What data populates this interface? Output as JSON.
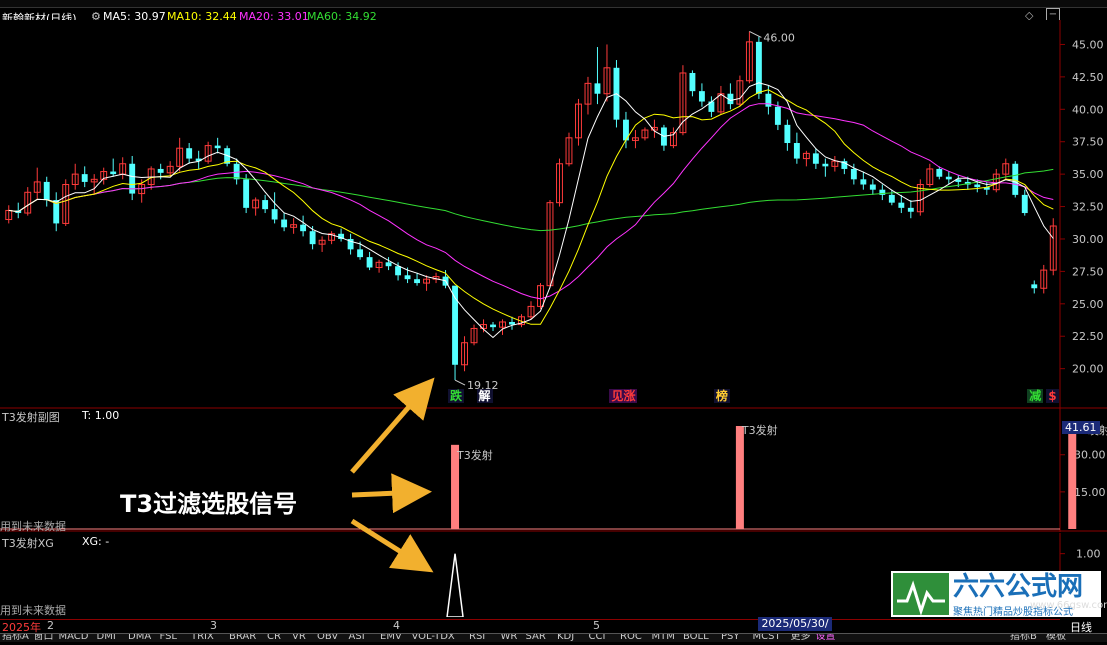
{
  "header": {
    "stock_name": "新翰新材(日线)",
    "ma5": "MA5: 30.97",
    "ma10": "MA10: 32.44",
    "ma20": "MA20: 33.01",
    "ma60": "MA60: 34.92"
  },
  "colors": {
    "up": "#ff3b3b",
    "down": "#54ffff",
    "ma5": "#ffffff",
    "ma10": "#ffff00",
    "ma20": "#ff33ff",
    "ma60": "#33dd33",
    "grid": "#8b0000",
    "bar": "#ff7f7f",
    "annotation_arrow": "#f2b02e"
  },
  "signals": [
    {
      "label": "跌",
      "color": "#33dd33"
    },
    {
      "label": "解",
      "color": "#ffffff"
    },
    {
      "label": "见涨",
      "color": "#ff3b3b"
    },
    {
      "label": "榜",
      "color": "#ffcc33"
    },
    {
      "label": "减",
      "color": "#33dd33"
    },
    {
      "label": "$",
      "color": "#ff3b3b"
    }
  ],
  "price_marks": {
    "high": "46.00",
    "low": "19.12"
  },
  "sub1": {
    "title": "T3发射副图",
    "value": "T: 1.00",
    "bar_label": "T3发射",
    "current_value": "41.61",
    "footer": "用到未来数据"
  },
  "sub2": {
    "title": "T3发射XG",
    "value": "XG: -",
    "footer": "用到未来数据"
  },
  "annotation": {
    "text": "T3过滤选股信号"
  },
  "x_axis": {
    "year": "2025年",
    "months": [
      "2",
      "3",
      "4",
      "5"
    ],
    "date_box": "2025/05/30/五",
    "period": "日线"
  },
  "bottom_tabs": [
    "指标A",
    "窗口",
    "MACD",
    "DMI",
    "DMA",
    "FSL",
    "TRIX",
    "BRAR",
    "CR",
    "VR",
    "OBV",
    "ASI",
    "EMV",
    "VOL-TDX",
    "RSI",
    "WR",
    "SAR",
    "KDJ",
    "CCI",
    "ROC",
    "MTM",
    "BOLL",
    "PSY",
    "MCST",
    "更多",
    "设置"
  ],
  "bottom_right": [
    "指标B",
    "模板"
  ],
  "logo": {
    "main": "六六公式网",
    "sub": "聚焦热门精品炒股指标公式",
    "url": "www.66gsw.com"
  },
  "chart_data": [
    {
      "type": "candlestick",
      "ylim": [
        18.2,
        46.5
      ],
      "yticks": [
        20.0,
        22.5,
        25.0,
        27.5,
        30.0,
        32.5,
        35.0,
        37.5,
        40.0,
        42.5,
        45.0
      ],
      "ohlc": [
        [
          31.5,
          32.6,
          31.2,
          32.2
        ],
        [
          32.2,
          32.8,
          31.6,
          32.0
        ],
        [
          32.0,
          34.0,
          31.8,
          33.6
        ],
        [
          33.6,
          35.5,
          33.0,
          34.4
        ],
        [
          34.4,
          34.8,
          32.5,
          33.0
        ],
        [
          33.0,
          33.6,
          30.6,
          31.2
        ],
        [
          31.2,
          34.6,
          31.0,
          34.2
        ],
        [
          34.2,
          35.8,
          33.8,
          35.0
        ],
        [
          35.0,
          35.6,
          34.0,
          34.4
        ],
        [
          34.4,
          35.0,
          33.4,
          34.6
        ],
        [
          34.6,
          35.5,
          34.2,
          35.2
        ],
        [
          35.2,
          36.2,
          34.8,
          35.0
        ],
        [
          35.0,
          36.3,
          34.6,
          35.8
        ],
        [
          35.8,
          36.4,
          33.0,
          33.5
        ],
        [
          33.5,
          34.6,
          32.8,
          34.2
        ],
        [
          34.2,
          35.6,
          33.8,
          35.4
        ],
        [
          35.4,
          35.8,
          34.6,
          35.1
        ],
        [
          35.1,
          36.0,
          34.8,
          35.6
        ],
        [
          35.6,
          37.8,
          35.2,
          37.0
        ],
        [
          37.0,
          37.4,
          35.8,
          36.2
        ],
        [
          36.2,
          36.8,
          35.4,
          36.0
        ],
        [
          36.0,
          37.5,
          35.8,
          37.2
        ],
        [
          37.2,
          37.8,
          36.6,
          37.0
        ],
        [
          37.0,
          37.2,
          35.6,
          35.8
        ],
        [
          35.8,
          36.2,
          34.2,
          34.6
        ],
        [
          34.6,
          35.0,
          32.0,
          32.4
        ],
        [
          32.4,
          33.2,
          31.8,
          33.0
        ],
        [
          33.0,
          33.4,
          32.0,
          32.3
        ],
        [
          32.3,
          33.6,
          31.2,
          31.5
        ],
        [
          31.5,
          32.0,
          30.6,
          30.9
        ],
        [
          30.9,
          31.6,
          30.4,
          31.1
        ],
        [
          31.1,
          31.8,
          30.2,
          30.6
        ],
        [
          30.6,
          31.0,
          29.2,
          29.6
        ],
        [
          29.6,
          30.2,
          29.0,
          29.9
        ],
        [
          29.9,
          30.6,
          29.6,
          30.4
        ],
        [
          30.4,
          30.8,
          29.8,
          30.0
        ],
        [
          30.0,
          30.4,
          28.8,
          29.2
        ],
        [
          29.2,
          29.8,
          28.4,
          28.6
        ],
        [
          28.6,
          29.0,
          27.6,
          27.8
        ],
        [
          27.8,
          28.4,
          27.4,
          28.2
        ],
        [
          28.2,
          28.6,
          27.6,
          27.9
        ],
        [
          27.9,
          28.2,
          26.8,
          27.2
        ],
        [
          27.2,
          27.8,
          26.6,
          26.9
        ],
        [
          26.9,
          27.4,
          26.4,
          26.6
        ],
        [
          26.6,
          27.2,
          26.0,
          26.9
        ],
        [
          26.9,
          27.4,
          26.6,
          27.1
        ],
        [
          27.1,
          27.6,
          26.2,
          26.4
        ],
        [
          26.4,
          25.0,
          19.12,
          20.3
        ],
        [
          20.3,
          22.5,
          19.8,
          22.0
        ],
        [
          22.0,
          23.4,
          21.8,
          23.1
        ],
        [
          23.1,
          23.8,
          22.8,
          23.4
        ],
        [
          23.4,
          23.6,
          22.9,
          23.2
        ],
        [
          23.2,
          23.8,
          22.6,
          23.6
        ],
        [
          23.6,
          24.0,
          23.0,
          23.4
        ],
        [
          23.4,
          24.2,
          23.2,
          24.0
        ],
        [
          24.0,
          25.2,
          23.8,
          24.8
        ],
        [
          24.8,
          26.6,
          24.6,
          26.4
        ],
        [
          26.4,
          33.0,
          26.2,
          32.8
        ],
        [
          32.8,
          36.2,
          32.5,
          35.8
        ],
        [
          35.8,
          38.2,
          35.6,
          37.8
        ],
        [
          37.8,
          40.8,
          37.2,
          40.4
        ],
        [
          40.4,
          42.5,
          39.6,
          42.0
        ],
        [
          42.0,
          44.8,
          40.4,
          41.2
        ],
        [
          41.2,
          45.0,
          40.6,
          43.2
        ],
        [
          43.2,
          43.8,
          38.6,
          39.2
        ],
        [
          39.2,
          39.8,
          37.0,
          37.6
        ],
        [
          37.6,
          38.4,
          37.0,
          37.8
        ],
        [
          37.8,
          38.6,
          37.6,
          38.4
        ],
        [
          38.4,
          39.2,
          37.8,
          38.6
        ],
        [
          38.6,
          38.8,
          36.8,
          37.2
        ],
        [
          37.2,
          38.6,
          37.0,
          38.2
        ],
        [
          38.2,
          43.4,
          38.0,
          42.8
        ],
        [
          42.8,
          43.0,
          41.0,
          41.4
        ],
        [
          41.4,
          42.0,
          40.2,
          40.6
        ],
        [
          40.6,
          41.0,
          39.4,
          39.8
        ],
        [
          39.8,
          41.8,
          39.6,
          41.2
        ],
        [
          41.2,
          42.0,
          40.0,
          40.4
        ],
        [
          40.4,
          42.6,
          40.2,
          42.2
        ],
        [
          42.2,
          46.0,
          42.0,
          45.2
        ],
        [
          45.2,
          45.6,
          40.8,
          41.2
        ],
        [
          41.2,
          41.8,
          39.6,
          40.2
        ],
        [
          40.2,
          40.6,
          38.4,
          38.8
        ],
        [
          38.8,
          39.2,
          36.8,
          37.4
        ],
        [
          37.4,
          38.2,
          35.8,
          36.2
        ],
        [
          36.2,
          36.8,
          35.6,
          36.6
        ],
        [
          36.6,
          37.0,
          35.4,
          35.8
        ],
        [
          35.8,
          36.2,
          34.8,
          35.6
        ],
        [
          35.6,
          36.4,
          35.2,
          36.0
        ],
        [
          36.0,
          36.2,
          35.0,
          35.4
        ],
        [
          35.4,
          35.8,
          34.2,
          34.6
        ],
        [
          34.6,
          35.2,
          33.8,
          34.2
        ],
        [
          34.2,
          34.6,
          33.4,
          33.8
        ],
        [
          33.8,
          34.2,
          33.0,
          33.4
        ],
        [
          33.4,
          33.8,
          32.6,
          32.8
        ],
        [
          32.8,
          33.4,
          32.0,
          32.4
        ],
        [
          32.4,
          33.0,
          31.6,
          32.1
        ],
        [
          32.1,
          34.6,
          31.8,
          34.2
        ],
        [
          34.2,
          35.8,
          34.0,
          35.4
        ],
        [
          35.4,
          35.6,
          34.6,
          34.8
        ],
        [
          34.8,
          35.2,
          34.2,
          34.6
        ],
        [
          34.6,
          34.9,
          34.0,
          34.4
        ],
        [
          34.4,
          34.8,
          33.8,
          34.2
        ],
        [
          34.2,
          34.6,
          33.6,
          34.0
        ],
        [
          34.0,
          34.4,
          33.4,
          33.8
        ],
        [
          33.8,
          35.4,
          33.6,
          35.0
        ],
        [
          35.0,
          36.2,
          34.6,
          35.8
        ],
        [
          35.8,
          36.0,
          33.2,
          33.4
        ],
        [
          33.4,
          33.8,
          31.8,
          32.0
        ],
        [
          26.5,
          26.8,
          25.8,
          26.2
        ],
        [
          26.2,
          28.0,
          25.8,
          27.6
        ],
        [
          27.6,
          31.6,
          27.2,
          31.0
        ]
      ]
    },
    {
      "type": "bar",
      "title": "T3发射副图",
      "ylim": [
        0,
        41.61
      ],
      "yticks": [
        15.0,
        30.0
      ],
      "signal_indices": [
        47,
        77,
        112
      ],
      "values": [
        34.0,
        41.61,
        41.61
      ]
    },
    {
      "type": "area",
      "title": "T3发射XG",
      "ylim": [
        0,
        1.2
      ],
      "yticks": [
        0.5,
        1.0
      ],
      "spike_index": 47,
      "value": 1.0
    }
  ]
}
